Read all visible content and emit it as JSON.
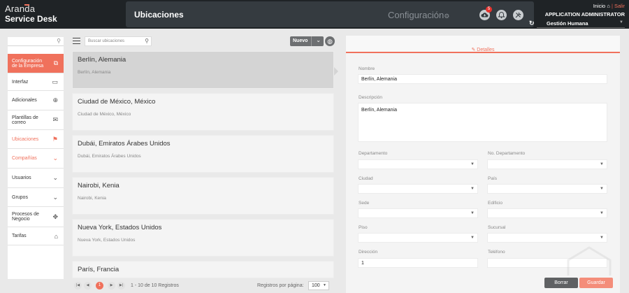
{
  "brand": {
    "line1": "Aranda",
    "line2": "Service Desk"
  },
  "header": {
    "title": "Ubicaciones",
    "section": "Configuración",
    "notification_count": "5",
    "links": {
      "home": "Inicio",
      "logout": "Salir"
    },
    "role": "APPLICATION ADMINISTRATOR",
    "project": "Gestión Humana"
  },
  "sidebar": {
    "items": [
      {
        "label": "Configuración de la Empresa",
        "icon": "building-icon",
        "state": "active"
      },
      {
        "label": "Interfaz",
        "icon": "monitor-icon"
      },
      {
        "label": "Adicionales",
        "icon": "plus-circle-icon"
      },
      {
        "label": "Plantillas de correo",
        "icon": "mail-icon"
      },
      {
        "label": "Ubicaciones",
        "icon": "signpost-icon",
        "state": "current"
      },
      {
        "label": "Compañías",
        "icon": "chevron-down-icon",
        "state": "current"
      },
      {
        "label": "Usuarios",
        "icon": "chevron-down-icon"
      },
      {
        "label": "Grupos",
        "icon": "chevron-down-icon"
      },
      {
        "label": "Procesos de Negocio",
        "icon": "move-icon"
      },
      {
        "label": "Tarifas",
        "icon": "bank-icon"
      }
    ]
  },
  "list": {
    "search_placeholder": "Buscar ubicaciones",
    "new_label": "Nuevo",
    "items": [
      {
        "name": "Berlín, Alemania",
        "sub": "Berlín, Alemania"
      },
      {
        "name": "Ciudad de México, México",
        "sub": "Ciudad de México, México"
      },
      {
        "name": "Dubái, Emiratos Árabes Unidos",
        "sub": "Dubái, Emiratos Árabes Unidos"
      },
      {
        "name": "Nairobi, Kenia",
        "sub": "Nairobi, Kenia"
      },
      {
        "name": "Nueva York, Estados Unidos",
        "sub": "Nueva York, Estados Unidos"
      },
      {
        "name": "París, Francia",
        "sub": ""
      }
    ],
    "pager": {
      "current_page": "1",
      "summary": "1 - 10 de 10 Registros",
      "per_page_label": "Registros por página:",
      "per_page": "100"
    }
  },
  "detail": {
    "tab_label": "Detalles",
    "fields": {
      "nombre_label": "Nombre",
      "nombre": "Berlín, Alemania",
      "descripcion_label": "Descripción",
      "descripcion": "Berlín, Alemania",
      "departamento_label": "Departamento",
      "no_departamento_label": "No. Departamento",
      "ciudad_label": "Ciudad",
      "pais_label": "País",
      "sede_label": "Sede",
      "edificio_label": "Edificio",
      "piso_label": "Piso",
      "sucursal_label": "Sucursal",
      "direccion_label": "Dirección",
      "direccion": "1",
      "telefono_label": "Teléfono",
      "telefono": ""
    },
    "buttons": {
      "delete": "Borrar",
      "save": "Guardar"
    }
  },
  "colors": {
    "accent": "#f0715c",
    "header_bg": "#1f2326",
    "titlebar_bg": "#353b40"
  }
}
